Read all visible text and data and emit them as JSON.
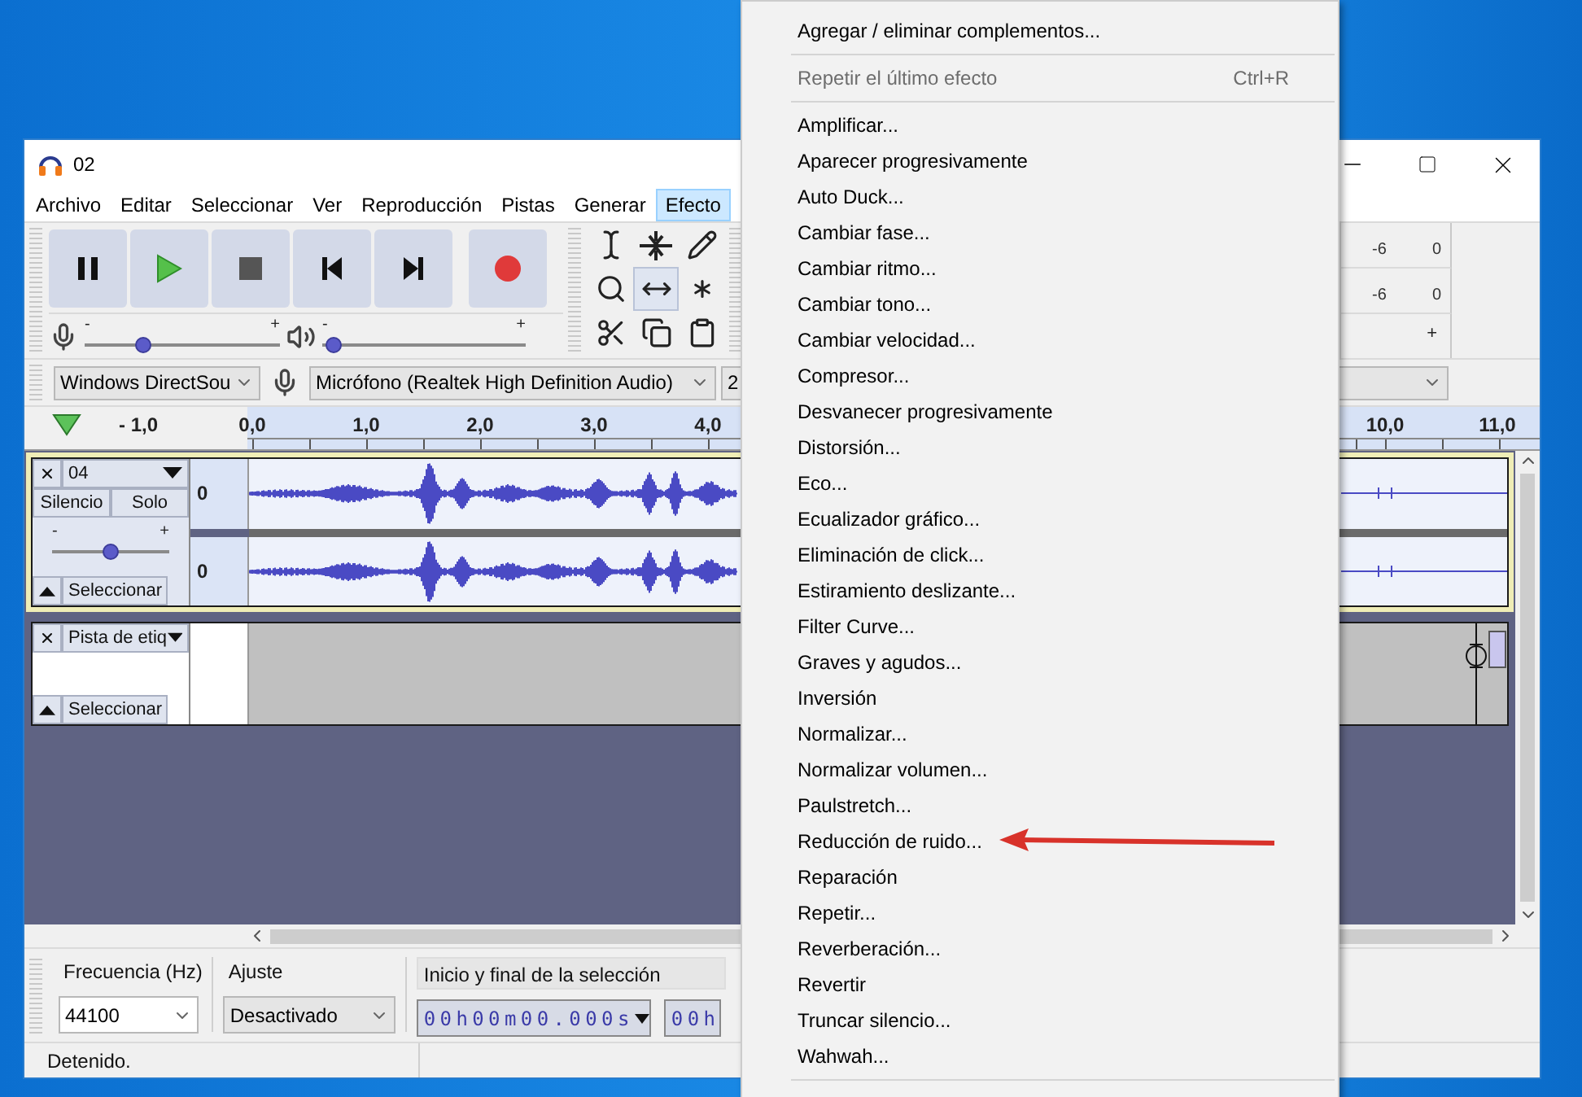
{
  "window": {
    "title": "02"
  },
  "menubar": [
    {
      "label": "Archivo",
      "selected": false
    },
    {
      "label": "Editar",
      "selected": false
    },
    {
      "label": "Seleccionar",
      "selected": false
    },
    {
      "label": "Ver",
      "selected": false
    },
    {
      "label": "Reproducción",
      "selected": false
    },
    {
      "label": "Pistas",
      "selected": false
    },
    {
      "label": "Generar",
      "selected": false
    },
    {
      "label": "Efecto",
      "selected": true
    }
  ],
  "sliders": [
    {
      "kind": "recording",
      "level": 0.28,
      "min_label": "-",
      "max_label": "+"
    },
    {
      "kind": "playback",
      "level": 0.02,
      "min_label": "-",
      "max_label": "+"
    }
  ],
  "devices": {
    "host": "Windows DirectSou",
    "input": "Micrófono (Realtek High Definition Audio)",
    "channels": "2"
  },
  "right_panel": {
    "meters": [
      {
        "labels": [
          "-6",
          "0"
        ]
      },
      {
        "labels": [
          "-6",
          "0"
        ]
      }
    ],
    "slider_max_label": "+"
  },
  "ruler": {
    "left_ticks": [
      "- 1,0",
      "0,0",
      "1,0",
      "2,0",
      "3,0",
      "4,0"
    ],
    "right_ticks": [
      "10,0",
      "11,0"
    ]
  },
  "tracks": [
    {
      "kind": "audio",
      "name": "04",
      "selected": true,
      "mute_label": "Silencio",
      "solo_label": "Solo",
      "gain": {
        "min_label": "-",
        "max_label": "+",
        "level": 0.5
      },
      "select_label": "Seleccionar",
      "channels": [
        {
          "scale": "0"
        },
        {
          "scale": "0"
        }
      ]
    },
    {
      "kind": "label",
      "name": "Pista de etiq",
      "selected": false,
      "select_label": "Seleccionar"
    }
  ],
  "selection_toolbar": {
    "rate_label": "Frecuencia (Hz)",
    "rate": "44100",
    "snap_label": "Ajuste",
    "snap": "Desactivado",
    "range_label": "Inicio y final de la selección",
    "start": "00h00m00.000s",
    "end": "00h"
  },
  "status_bar": {
    "text": "Detenido."
  },
  "effect_menu": {
    "items": [
      {
        "kind": "item",
        "label": "Agregar / eliminar complementos...",
        "disabled": false,
        "pointed": false
      },
      {
        "kind": "separator"
      },
      {
        "kind": "item",
        "label": "Repetir el último efecto",
        "shortcut": "Ctrl+R",
        "disabled": true,
        "pointed": false
      },
      {
        "kind": "separator"
      },
      {
        "kind": "item",
        "label": "Amplificar...",
        "disabled": false,
        "pointed": false
      },
      {
        "kind": "item",
        "label": "Aparecer progresivamente",
        "disabled": false,
        "pointed": false
      },
      {
        "kind": "item",
        "label": "Auto Duck...",
        "disabled": false,
        "pointed": false
      },
      {
        "kind": "item",
        "label": "Cambiar fase...",
        "disabled": false,
        "pointed": false
      },
      {
        "kind": "item",
        "label": "Cambiar ritmo...",
        "disabled": false,
        "pointed": false
      },
      {
        "kind": "item",
        "label": "Cambiar tono...",
        "disabled": false,
        "pointed": false
      },
      {
        "kind": "item",
        "label": "Cambiar velocidad...",
        "disabled": false,
        "pointed": false
      },
      {
        "kind": "item",
        "label": "Compresor...",
        "disabled": false,
        "pointed": false
      },
      {
        "kind": "item",
        "label": "Desvanecer progresivamente",
        "disabled": false,
        "pointed": false
      },
      {
        "kind": "item",
        "label": "Distorsión...",
        "disabled": false,
        "pointed": false
      },
      {
        "kind": "item",
        "label": "Eco...",
        "disabled": false,
        "pointed": false
      },
      {
        "kind": "item",
        "label": "Ecualizador gráfico...",
        "disabled": false,
        "pointed": false
      },
      {
        "kind": "item",
        "label": "Eliminación de click...",
        "disabled": false,
        "pointed": false
      },
      {
        "kind": "item",
        "label": "Estiramiento deslizante...",
        "disabled": false,
        "pointed": false
      },
      {
        "kind": "item",
        "label": "Filter Curve...",
        "disabled": false,
        "pointed": false
      },
      {
        "kind": "item",
        "label": "Graves y agudos...",
        "disabled": false,
        "pointed": false
      },
      {
        "kind": "item",
        "label": "Inversión",
        "disabled": false,
        "pointed": false
      },
      {
        "kind": "item",
        "label": "Normalizar...",
        "disabled": false,
        "pointed": false
      },
      {
        "kind": "item",
        "label": "Normalizar volumen...",
        "disabled": false,
        "pointed": false
      },
      {
        "kind": "item",
        "label": "Paulstretch...",
        "disabled": false,
        "pointed": false
      },
      {
        "kind": "item",
        "label": "Reducción de ruido...",
        "disabled": false,
        "pointed": true
      },
      {
        "kind": "item",
        "label": "Reparación",
        "disabled": false,
        "pointed": false
      },
      {
        "kind": "item",
        "label": "Repetir...",
        "disabled": false,
        "pointed": false
      },
      {
        "kind": "item",
        "label": "Reverberación...",
        "disabled": false,
        "pointed": false
      },
      {
        "kind": "item",
        "label": "Revertir",
        "disabled": false,
        "pointed": false
      },
      {
        "kind": "item",
        "label": "Truncar silencio...",
        "disabled": false,
        "pointed": false
      },
      {
        "kind": "item",
        "label": "Wahwah...",
        "disabled": false,
        "pointed": false
      },
      {
        "kind": "separator"
      }
    ]
  }
}
